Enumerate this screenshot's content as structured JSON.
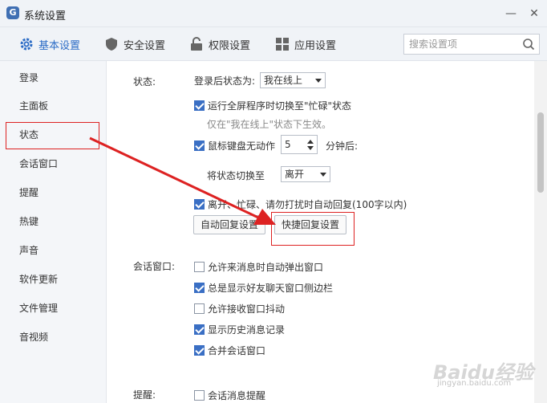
{
  "window": {
    "title": "系统设置",
    "logo_letter": "G"
  },
  "top_nav": {
    "tabs": [
      {
        "label": "基本设置",
        "icon": "gear-icon",
        "active": true
      },
      {
        "label": "安全设置",
        "icon": "shield-icon",
        "active": false
      },
      {
        "label": "权限设置",
        "icon": "lock-icon",
        "active": false
      },
      {
        "label": "应用设置",
        "icon": "apps-icon",
        "active": false
      }
    ],
    "search_placeholder": "搜索设置项"
  },
  "sidebar": {
    "items": [
      "登录",
      "主面板",
      "状态",
      "会话窗口",
      "提醒",
      "热键",
      "声音",
      "软件更新",
      "文件管理",
      "音视频"
    ],
    "selected": "状态"
  },
  "status_section": {
    "label": "状态:",
    "login_status_label": "登录后状态为:",
    "login_status_value": "我在线上",
    "fullscreen_busy": {
      "label": "运行全屏程序时切换至\"忙碌\"状态",
      "checked": true
    },
    "fullscreen_hint": "仅在\"我在线上\"状态下生效。",
    "idle": {
      "label": "鼠标键盘无动作",
      "checked": true,
      "minutes": "5",
      "unit": "分钟后:"
    },
    "switch_to_label": "将状态切换至",
    "switch_to_value": "离开",
    "auto_reply": {
      "label": "离开、忙碌、请勿打扰时自动回复(100字以内)",
      "checked": true
    },
    "auto_reply_button": "自动回复设置",
    "quick_reply_button": "快捷回复设置"
  },
  "session_section": {
    "label": "会话窗口:",
    "options": [
      {
        "label": "允许来消息时自动弹出窗口",
        "checked": false
      },
      {
        "label": "总是显示好友聊天窗口侧边栏",
        "checked": true
      },
      {
        "label": "允许接收窗口抖动",
        "checked": false
      },
      {
        "label": "显示历史消息记录",
        "checked": true
      },
      {
        "label": "合并会话窗口",
        "checked": true
      }
    ]
  },
  "reminder_section": {
    "label": "提醒:",
    "options": [
      {
        "label": "会话消息提醒",
        "checked": false
      }
    ]
  },
  "watermark": {
    "brand": "Baidu经验",
    "url": "jingyan.baidu.com"
  },
  "colors": {
    "accent": "#2c6cc6",
    "highlight_red": "#dd2222",
    "checkbox_blue": "#3a6fc4"
  }
}
